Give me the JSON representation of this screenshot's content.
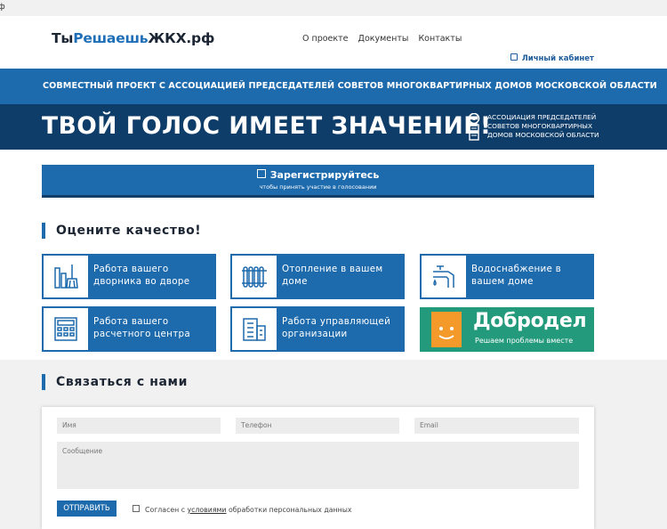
{
  "browser": {
    "fragment": "ф"
  },
  "header": {
    "logo": {
      "part1": "Ты",
      "part2": "Решаешь",
      "part3": "ЖКХ.рф"
    },
    "nav": [
      "О проекте",
      "Документы",
      "Контакты"
    ],
    "cabinet": "Личный кабинет"
  },
  "banner": {
    "subtitle": "СОВМЕСТНЫЙ ПРОЕКТ С АССОЦИАЦИЕЙ ПРЕДСЕДАТЕЛЕЙ СОВЕТОВ МНОГОКВАРТИРНЫХ ДОМОВ МОСКОВСКОЙ ОБЛАСТИ",
    "title": "ТВОЙ ГОЛОС ИМЕЕТ ЗНАЧЕНИЕ!",
    "association": [
      "АССОЦИАЦИЯ ПРЕДСЕДАТЕЛЕЙ",
      "СОВЕТОВ МНОГОКВАРТИРНЫХ",
      "ДОМОВ МОСКОВСКОЙ ОБЛАСТИ"
    ]
  },
  "register": {
    "label": "Зарегистрируйтесь",
    "sub": "чтобы принять участие в голосовании"
  },
  "rate": {
    "heading": "Оцените качество!",
    "tiles": [
      {
        "label": "Работа вашего дворника во дворе",
        "icon": "broom-icon"
      },
      {
        "label": "Отопление в вашем доме",
        "icon": "radiator-icon"
      },
      {
        "label": "Водоснабжение в вашем доме",
        "icon": "faucet-icon"
      },
      {
        "label": "Работа вашего расчетного центра",
        "icon": "calculator-icon"
      },
      {
        "label": "Работа управляющей организации",
        "icon": "building-icon"
      }
    ],
    "dobrodel": {
      "name": "Добродел",
      "tagline": "Решаем проблемы вместе"
    }
  },
  "contact": {
    "heading": "Связаться с нами",
    "name_placeholder": "Имя",
    "phone_placeholder": "Телефон",
    "email_placeholder": "Email",
    "message_placeholder": "Сообщение",
    "submit": "ОТПРАВИТЬ",
    "agree_pre": "Согласен с ",
    "agree_link": "условиями",
    "agree_post": " обработки персональных данных"
  },
  "colors": {
    "primary": "#1d6aad",
    "dark": "#0f3d69",
    "dobrodel": "#239a7c",
    "dobrodel_face": "#f39a2a"
  }
}
